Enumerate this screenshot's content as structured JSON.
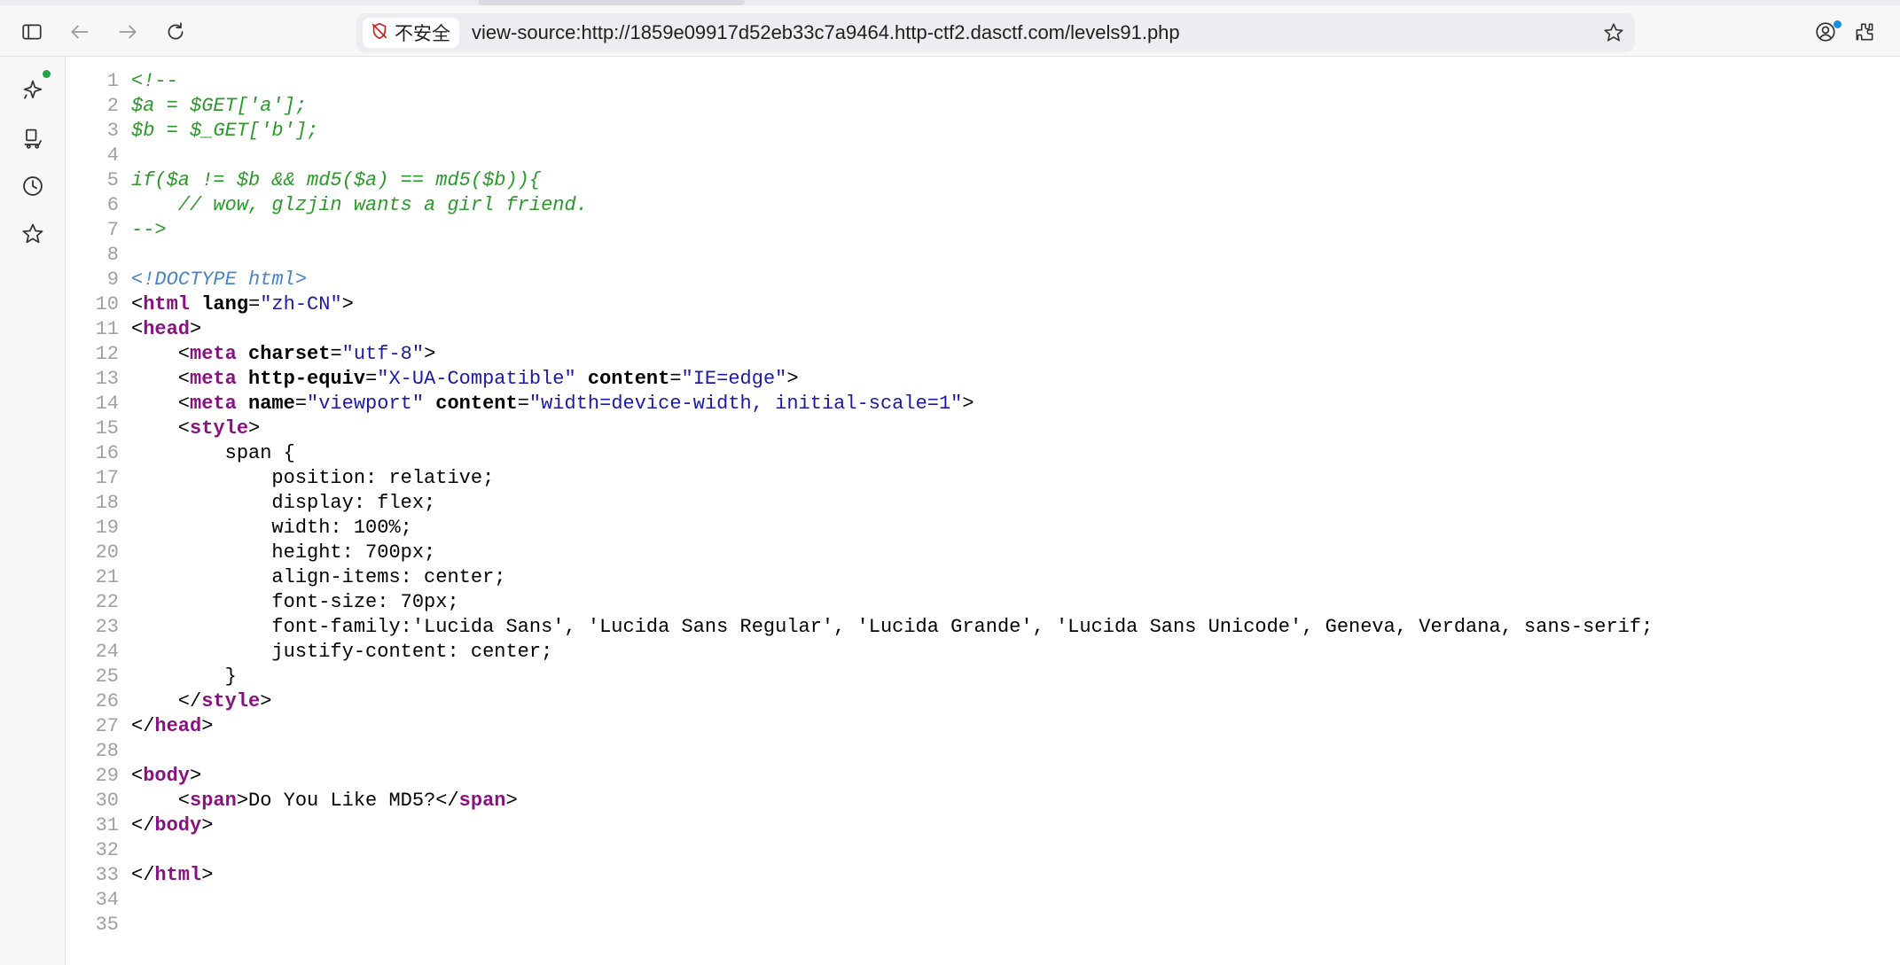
{
  "browser": {
    "security_label": "不安全",
    "url": "view-source:http://1859e09917d52eb33c7a9464.http-ctf2.dasctf.com/levels91.php",
    "icons": {
      "sidebar_toggle": "sidebar-toggle-icon",
      "back": "back-arrow-icon",
      "forward": "forward-arrow-icon",
      "reload": "reload-icon",
      "not_secure": "shield-slash-icon",
      "bookmark": "star-icon",
      "profile": "profile-icon",
      "extensions": "extensions-icon"
    },
    "sidebar_icons": [
      "copilot-sparkle-icon",
      "shopping-icon",
      "history-icon",
      "favorites-star-icon"
    ]
  },
  "colors": {
    "comment": "#2a9a2a",
    "doctype": "#4a84c5",
    "tag": "#881280",
    "attribute_value": "#1a1aa6",
    "line_number": "#a0a0a0"
  },
  "source_lines": [
    {
      "n": "1",
      "tokens": [
        {
          "t": "<!--",
          "c": "comment"
        }
      ]
    },
    {
      "n": "2",
      "tokens": [
        {
          "t": "$a = $GET['a'];",
          "c": "comment"
        }
      ]
    },
    {
      "n": "3",
      "tokens": [
        {
          "t": "$b = $_GET['b'];",
          "c": "comment"
        }
      ]
    },
    {
      "n": "4",
      "tokens": []
    },
    {
      "n": "5",
      "tokens": [
        {
          "t": "if($a != $b && md5($a) == md5($b)){",
          "c": "comment"
        }
      ]
    },
    {
      "n": "6",
      "tokens": [
        {
          "t": "    // wow, glzjin wants a girl friend.",
          "c": "comment"
        }
      ]
    },
    {
      "n": "7",
      "tokens": [
        {
          "t": "-->",
          "c": "comment"
        }
      ]
    },
    {
      "n": "8",
      "tokens": []
    },
    {
      "n": "9",
      "tokens": [
        {
          "t": "<!DOCTYPE html>",
          "c": "doctype"
        }
      ]
    },
    {
      "n": "10",
      "tokens": [
        {
          "t": "<",
          "c": "text"
        },
        {
          "t": "html",
          "c": "tag"
        },
        {
          "t": " ",
          "c": "text"
        },
        {
          "t": "lang",
          "c": "attr"
        },
        {
          "t": "=",
          "c": "text"
        },
        {
          "t": "\"zh-CN\"",
          "c": "val"
        },
        {
          "t": ">",
          "c": "text"
        }
      ]
    },
    {
      "n": "11",
      "tokens": [
        {
          "t": "<",
          "c": "text"
        },
        {
          "t": "head",
          "c": "tag"
        },
        {
          "t": ">",
          "c": "text"
        }
      ]
    },
    {
      "n": "12",
      "tokens": [
        {
          "t": "    <",
          "c": "text"
        },
        {
          "t": "meta",
          "c": "tag"
        },
        {
          "t": " ",
          "c": "text"
        },
        {
          "t": "charset",
          "c": "attr"
        },
        {
          "t": "=",
          "c": "text"
        },
        {
          "t": "\"utf-8\"",
          "c": "val"
        },
        {
          "t": ">",
          "c": "text"
        }
      ]
    },
    {
      "n": "13",
      "tokens": [
        {
          "t": "    <",
          "c": "text"
        },
        {
          "t": "meta",
          "c": "tag"
        },
        {
          "t": " ",
          "c": "text"
        },
        {
          "t": "http-equiv",
          "c": "attr"
        },
        {
          "t": "=",
          "c": "text"
        },
        {
          "t": "\"X-UA-Compatible\"",
          "c": "val"
        },
        {
          "t": " ",
          "c": "text"
        },
        {
          "t": "content",
          "c": "attr"
        },
        {
          "t": "=",
          "c": "text"
        },
        {
          "t": "\"IE=edge\"",
          "c": "val"
        },
        {
          "t": ">",
          "c": "text"
        }
      ]
    },
    {
      "n": "14",
      "tokens": [
        {
          "t": "    <",
          "c": "text"
        },
        {
          "t": "meta",
          "c": "tag"
        },
        {
          "t": " ",
          "c": "text"
        },
        {
          "t": "name",
          "c": "attr"
        },
        {
          "t": "=",
          "c": "text"
        },
        {
          "t": "\"viewport\"",
          "c": "val"
        },
        {
          "t": " ",
          "c": "text"
        },
        {
          "t": "content",
          "c": "attr"
        },
        {
          "t": "=",
          "c": "text"
        },
        {
          "t": "\"width=device-width, initial-scale=1\"",
          "c": "val"
        },
        {
          "t": ">",
          "c": "text"
        }
      ]
    },
    {
      "n": "15",
      "tokens": [
        {
          "t": "    <",
          "c": "text"
        },
        {
          "t": "style",
          "c": "tag"
        },
        {
          "t": ">",
          "c": "text"
        }
      ]
    },
    {
      "n": "16",
      "tokens": [
        {
          "t": "        span {",
          "c": "text"
        }
      ]
    },
    {
      "n": "17",
      "tokens": [
        {
          "t": "            position: relative;",
          "c": "text"
        }
      ]
    },
    {
      "n": "18",
      "tokens": [
        {
          "t": "            display: flex;",
          "c": "text"
        }
      ]
    },
    {
      "n": "19",
      "tokens": [
        {
          "t": "            width: 100%;",
          "c": "text"
        }
      ]
    },
    {
      "n": "20",
      "tokens": [
        {
          "t": "            height: 700px;",
          "c": "text"
        }
      ]
    },
    {
      "n": "21",
      "tokens": [
        {
          "t": "            align-items: center;",
          "c": "text"
        }
      ]
    },
    {
      "n": "22",
      "tokens": [
        {
          "t": "            font-size: 70px;",
          "c": "text"
        }
      ]
    },
    {
      "n": "23",
      "tokens": [
        {
          "t": "            font-family:'Lucida Sans', 'Lucida Sans Regular', 'Lucida Grande', 'Lucida Sans Unicode', Geneva, Verdana, sans-serif;",
          "c": "text"
        }
      ]
    },
    {
      "n": "24",
      "tokens": [
        {
          "t": "            justify-content: center;",
          "c": "text"
        }
      ]
    },
    {
      "n": "25",
      "tokens": [
        {
          "t": "        }",
          "c": "text"
        }
      ]
    },
    {
      "n": "26",
      "tokens": [
        {
          "t": "    </",
          "c": "text"
        },
        {
          "t": "style",
          "c": "tag"
        },
        {
          "t": ">",
          "c": "text"
        }
      ]
    },
    {
      "n": "27",
      "tokens": [
        {
          "t": "</",
          "c": "text"
        },
        {
          "t": "head",
          "c": "tag"
        },
        {
          "t": ">",
          "c": "text"
        }
      ]
    },
    {
      "n": "28",
      "tokens": []
    },
    {
      "n": "29",
      "tokens": [
        {
          "t": "<",
          "c": "text"
        },
        {
          "t": "body",
          "c": "tag"
        },
        {
          "t": ">",
          "c": "text"
        }
      ]
    },
    {
      "n": "30",
      "tokens": [
        {
          "t": "    <",
          "c": "text"
        },
        {
          "t": "span",
          "c": "tag"
        },
        {
          "t": ">Do You Like MD5?</",
          "c": "text"
        },
        {
          "t": "span",
          "c": "tag"
        },
        {
          "t": ">",
          "c": "text"
        }
      ]
    },
    {
      "n": "31",
      "tokens": [
        {
          "t": "</",
          "c": "text"
        },
        {
          "t": "body",
          "c": "tag"
        },
        {
          "t": ">",
          "c": "text"
        }
      ]
    },
    {
      "n": "32",
      "tokens": []
    },
    {
      "n": "33",
      "tokens": [
        {
          "t": "</",
          "c": "text"
        },
        {
          "t": "html",
          "c": "tag"
        },
        {
          "t": ">",
          "c": "text"
        }
      ]
    },
    {
      "n": "34",
      "tokens": []
    },
    {
      "n": "35",
      "tokens": []
    }
  ]
}
